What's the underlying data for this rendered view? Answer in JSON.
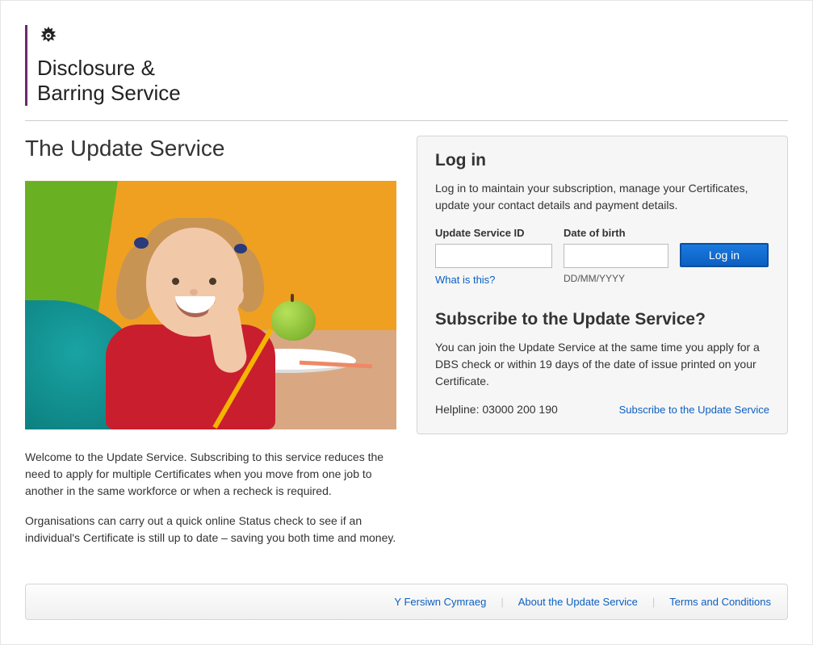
{
  "brand": {
    "line1": "Disclosure &",
    "line2": "Barring Service"
  },
  "page": {
    "title": "The Update Service",
    "intro1": "Welcome to the Update Service. Subscribing to this service reduces the need to apply for multiple Certificates when you move from one job to another in the same workforce or when a recheck is required.",
    "intro2": "Organisations can carry out a quick online Status check to see if an individual's Certificate is still up to date – saving you both time and money."
  },
  "login": {
    "heading": "Log in",
    "description": "Log in to maintain your subscription, manage your Certificates, update your contact details and payment details.",
    "id_label": "Update Service ID",
    "dob_label": "Date of birth",
    "button": "Log in",
    "what_is_this": "What is this?",
    "dob_hint": "DD/MM/YYYY"
  },
  "subscribe": {
    "heading": "Subscribe to the Update Service?",
    "description": "You can join the Update Service at the same time you apply for a DBS check or within 19 days of the date of issue printed on your Certificate.",
    "helpline": "Helpline: 03000 200 190",
    "link": "Subscribe to the Update Service"
  },
  "footer": {
    "welsh": "Y Fersiwn Cymraeg",
    "about": "About the Update Service",
    "terms": "Terms and Conditions"
  }
}
